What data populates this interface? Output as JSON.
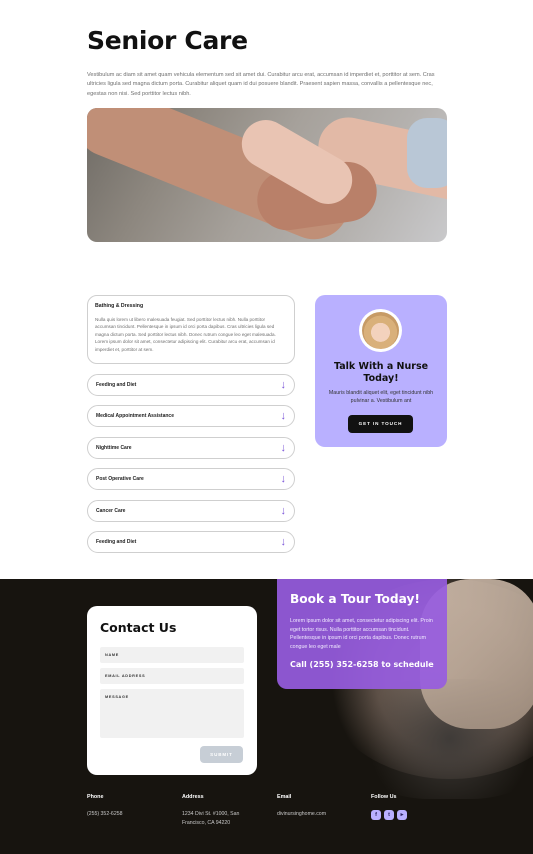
{
  "header": {
    "title": "Senior Care",
    "intro": "Vestibulum ac diam sit amet quam vehicula elementum sed sit amet dui. Curabitur arcu erat, accumsan id imperdiet et, porttitor at sem. Cras ultricies ligula sed magna dictum porta. Curabitur aliquet quam id dui posuere blandit. Praesent sapien massa, convallis a pellentesque nec, egestas non nisi. Sed porttitor lectus nibh."
  },
  "accordion": {
    "open": {
      "title": "Bathing & Dressing",
      "body": "Nulla quis lorem ut libero malesuada feugiat. Sed porttitor lectus nibh. Nulla porttitor accumsan tincidunt. Pellentesque in ipsum id orci porta dapibus. Cras ultricies ligula sed magna dictum porta. Sed porttitor lectus nibh. Donec rutrum congue leo eget malesuada. Lorem ipsum dolor sit amet, consectetur adipiscing elit. Curabitur arcu erat, accumsan id imperdiet et, porttitor at sem."
    },
    "items": [
      {
        "label": "Feeding and Diet"
      },
      {
        "label": "Medical Appointment Assistance"
      },
      {
        "label": "Nighttime Care"
      },
      {
        "label": "Post Operative Care"
      },
      {
        "label": "Cancer Care"
      },
      {
        "label": "Feeding and Diet"
      }
    ],
    "arrow_glyph": "↓"
  },
  "nurse_card": {
    "title": "Talk With a Nurse Today!",
    "text": "Mauris blandit aliquet elit, eget tincidunt nibh pulvinar a. Vestibulum ant",
    "button": "GET IN TOUCH"
  },
  "contact": {
    "title": "Contact Us",
    "fields": {
      "name": "NAME",
      "email": "EMAIL ADDRESS",
      "message": "MESSAGE"
    },
    "submit": "SUBMIT"
  },
  "tour": {
    "title": "Book a Tour Today!",
    "text": "Lorem ipsum dolor sit amet, consectetur adipiscing elit. Proin eget tortor risus. Nulla porttitor accumsan tincidunt. Pellentesque in ipsum id orci porta dapibus. Donec rutrum congue leo eget male",
    "phone": "Call (255) 352-6258 to schedule"
  },
  "footer": {
    "phone": {
      "heading": "Phone",
      "value": "(255) 352-6258"
    },
    "address": {
      "heading": "Address",
      "line1": "1234 Divi St. #1000, San",
      "line2": "Francisco, CA 94220"
    },
    "email": {
      "heading": "Email",
      "value": "divinursinghome.com"
    },
    "follow": {
      "heading": "Follow Us",
      "icons": [
        "facebook-icon",
        "twitter-icon",
        "youtube-icon"
      ]
    }
  },
  "colors": {
    "accent_lavender": "#b9b0ff",
    "accent_purple": "#975ce0",
    "dark_bg": "#17140f",
    "arrow": "#7b55d8"
  }
}
